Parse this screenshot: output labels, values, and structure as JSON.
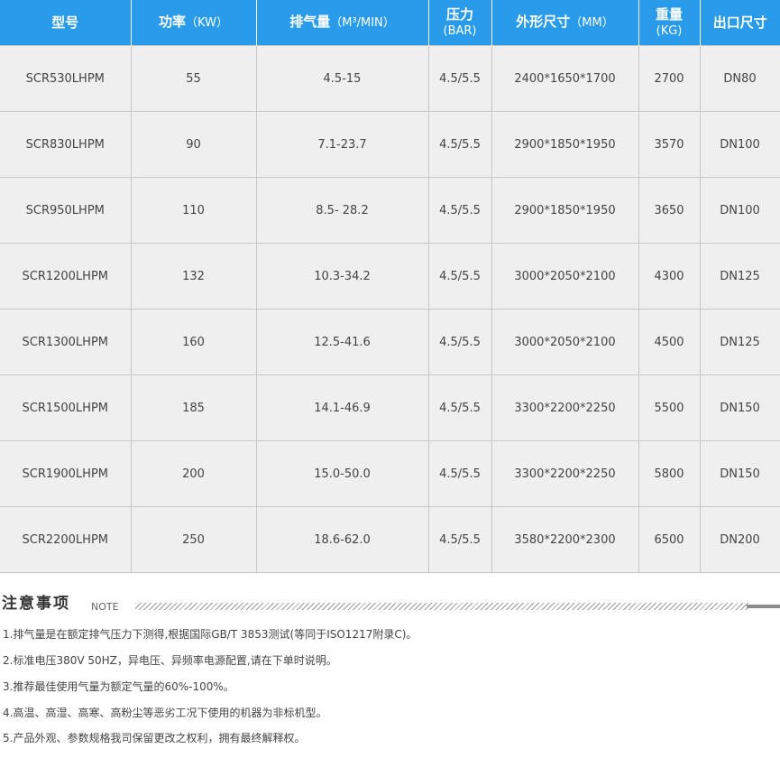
{
  "table": {
    "headers": [
      {
        "label": "型号",
        "unit": ""
      },
      {
        "label": "功率",
        "unit": "（KW）"
      },
      {
        "label": "排气量",
        "unit": "（M³/MIN）"
      },
      {
        "label": "压力",
        "unit": "(BAR)"
      },
      {
        "label": "外形尺寸",
        "unit": "（MM）"
      },
      {
        "label": "重量",
        "unit": "(KG)"
      },
      {
        "label": "出口尺寸",
        "unit": ""
      }
    ],
    "rows": [
      [
        "SCR530LHPM",
        "55",
        "4.5-15",
        "4.5/5.5",
        "2400*1650*1700",
        "2700",
        "DN80"
      ],
      [
        "SCR830LHPM",
        "90",
        "7.1-23.7",
        "4.5/5.5",
        "2900*1850*1950",
        "3570",
        "DN100"
      ],
      [
        "SCR950LHPM",
        "110",
        "8.5- 28.2",
        "4.5/5.5",
        "2900*1850*1950",
        "3650",
        "DN100"
      ],
      [
        "SCR1200LHPM",
        "132",
        "10.3-34.2",
        "4.5/5.5",
        "3000*2050*2100",
        "4300",
        "DN125"
      ],
      [
        "SCR1300LHPM",
        "160",
        "12.5-41.6",
        "4.5/5.5",
        "3000*2050*2100",
        "4500",
        "DN125"
      ],
      [
        "SCR1500LHPM",
        "185",
        "14.1-46.9",
        "4.5/5.5",
        "3300*2200*2250",
        "5500",
        "DN150"
      ],
      [
        "SCR1900LHPM",
        "200",
        "15.0-50.0",
        "4.5/5.5",
        "3300*2200*2250",
        "5800",
        "DN150"
      ],
      [
        "SCR2200LHPM",
        "250",
        "18.6-62.0",
        "4.5/5.5",
        "3580*2200*2300",
        "6500",
        "DN200"
      ]
    ]
  },
  "notes": {
    "title": "注意事项",
    "subtitle": "NOTE",
    "items": [
      "1.排气量是在额定排气压力下测得,根据国际GB/T 3853测试(等同于ISO1217附录C)。",
      "2.标准电压380V 50HZ，异电压、异频率电源配置,请在下单时说明。",
      "3.推荐最佳使用气量为额定气量的60%-100%。",
      "4.高温、高湿、高寒、高粉尘等恶劣工况下使用的机器为非标机型。",
      "5.产品外观、参数规格我司保留更改之权利，拥有最终解释权。"
    ]
  }
}
